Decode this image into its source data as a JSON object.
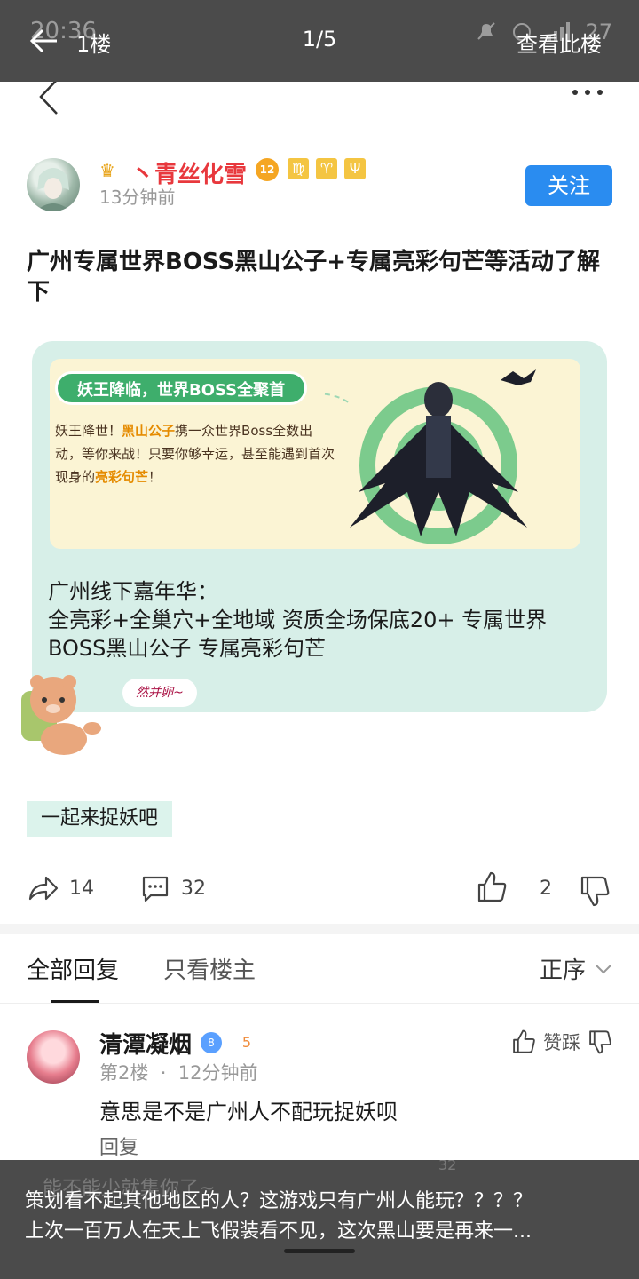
{
  "overlay_top": {
    "status_time": "20:36",
    "floor": "1楼",
    "pager": "1/5",
    "view_floor": "查看此楼",
    "battery": "27"
  },
  "author": {
    "crown_glyph": "♛",
    "name": "丶青丝化雪",
    "level": "12",
    "zodiac": [
      "♍",
      "♈",
      "Ψ"
    ],
    "time": "13分钟前",
    "follow": "关注"
  },
  "post": {
    "title": "广州专属世界BOSS黑山公子+专属亮彩句芒等活动了解下",
    "image": {
      "banner_tag": "妖王降临，世界BOSS全聚首",
      "banner_text_1": "妖王降世！",
      "banner_highlight_1": "黑山公子",
      "banner_text_2": "携一众世界Boss全数出动，等你来战！只要你够幸运，甚至能遇到首次现身的",
      "banner_highlight_2": "亮彩句芒",
      "banner_text_3": "！",
      "line1": "广州线下嘉年华：",
      "line2": "全亮彩+全巢穴+全地域 资质全场保底20+ 专属世界BOSS黑山公子 专属亮彩句芒",
      "sticker_text": "然并卵~"
    },
    "topic": "一起来捉妖吧",
    "shares": "14",
    "comments": "32",
    "likes": "2"
  },
  "tabs": {
    "all": "全部回复",
    "owner_only": "只看楼主",
    "sort": "正序"
  },
  "reply": {
    "name": "清潭凝烟",
    "badge": "8",
    "badge2": "5",
    "floor": "第2楼",
    "dot": "·",
    "time": "12分钟前",
    "body": "意思是不是广州人不配玩捉妖呗",
    "reply_label": "回复",
    "vote_label": "赞踩"
  },
  "overlay_bottom": {
    "ghost_input": "能不能少就集你了~",
    "ghost_count": "32",
    "caption_line1": "策划看不起其他地区的人？这游戏只有广州人能玩？？？？",
    "caption_line2": "上次一百万人在天上飞假装看不见，这次黑山要是再来一..."
  }
}
